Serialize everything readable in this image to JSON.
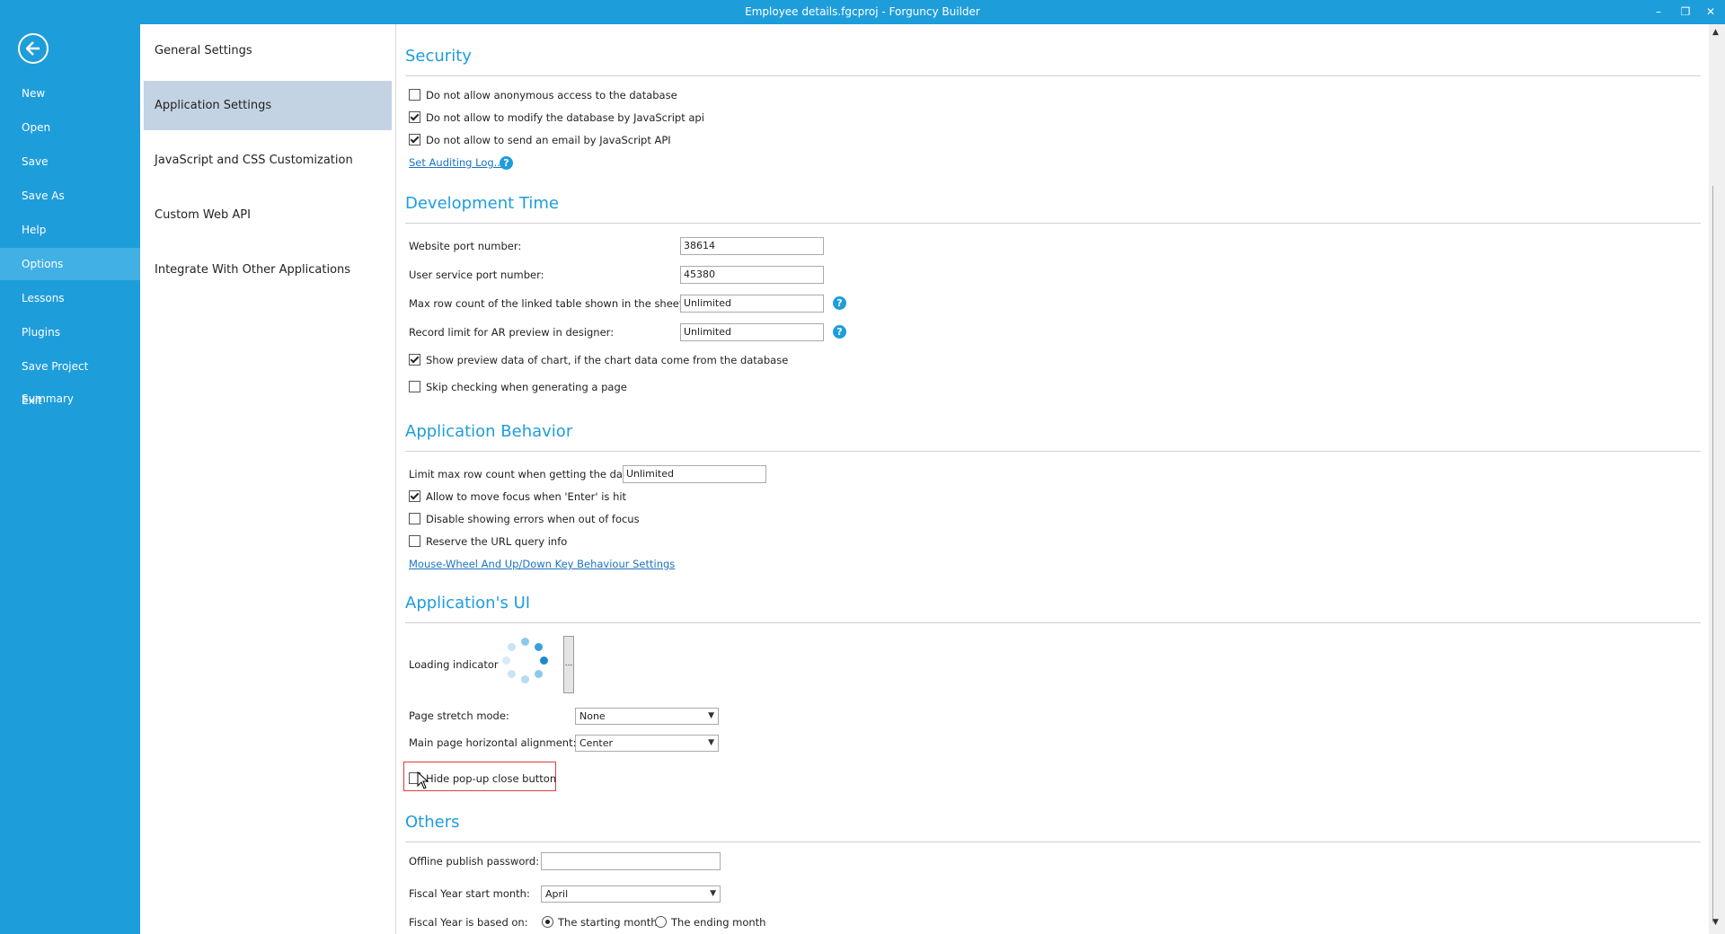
{
  "window": {
    "title": "Employee details.fgcproj - Forguncy Builder",
    "minimize": "–",
    "restore": "❐",
    "close": "✕"
  },
  "nav": {
    "back_icon": "back-arrow-icon",
    "items": [
      "New",
      "Open",
      "Save",
      "Save As",
      "Help",
      "Options",
      "Lessons",
      "Plugins",
      "Save Project Summary",
      "Exit"
    ],
    "active": "Options"
  },
  "settings_nav": {
    "items": [
      "General Settings",
      "Application Settings",
      "JavaScript and CSS Customization",
      "Custom Web API",
      "Integrate With Other Applications"
    ],
    "active": "Application Settings"
  },
  "security": {
    "title": "Security",
    "anon_label": "Do not allow anonymous access to the database",
    "anon_checked": false,
    "modify_label": "Do not allow to modify the database by JavaScript api",
    "modify_checked": true,
    "email_label": "Do not allow to send an email by JavaScript API",
    "email_checked": true,
    "audit_link": "Set Auditing Log...",
    "help": "?"
  },
  "devtime": {
    "title": "Development Time",
    "website_port_label": "Website port number:",
    "website_port": "38614",
    "user_port_label": "User service port number:",
    "user_port": "45380",
    "max_row_label": "Max row count of the linked table shown in the sheet:",
    "max_row": "Unlimited",
    "record_limit_label": "Record limit for AR preview in designer:",
    "record_limit": "Unlimited",
    "preview_label": "Show preview data of chart, if the chart data come from the database",
    "preview_checked": true,
    "skip_label": "Skip checking when generating a page",
    "skip_checked": false
  },
  "behavior": {
    "title": "Application Behavior",
    "limit_label": "Limit max row count when getting the data:",
    "limit_value": "Unlimited",
    "enter_label": "Allow to move focus when 'Enter' is hit",
    "enter_checked": true,
    "errors_label": "Disable showing errors when out of focus",
    "errors_checked": false,
    "url_label": "Reserve the URL query info",
    "url_checked": false,
    "mouse_link": "Mouse-Wheel And Up/Down Key Behaviour Settings"
  },
  "ui": {
    "title": "Application's UI",
    "loading_label": "Loading indicator",
    "loading_btn": "...",
    "stretch_label": "Page stretch mode:",
    "stretch_value": "None",
    "align_label": "Main page horizontal alignment:",
    "align_value": "Center",
    "hide_close_label": "Hide pop-up close button",
    "hide_close_checked": false
  },
  "others": {
    "title": "Others",
    "password_label": "Offline publish password:",
    "password_value": "",
    "fiscal_month_label": "Fiscal Year start month:",
    "fiscal_month_value": "April",
    "fiscal_based_label": "Fiscal Year is based on:",
    "starting_label": "The starting month",
    "ending_label": "The ending month",
    "based_on": "starting"
  },
  "colors": {
    "accent": "#1e9ddb",
    "nav_active": "#41b0e4",
    "settings_active": "#c4d3e3",
    "highlight_box": "#e23b3b"
  }
}
